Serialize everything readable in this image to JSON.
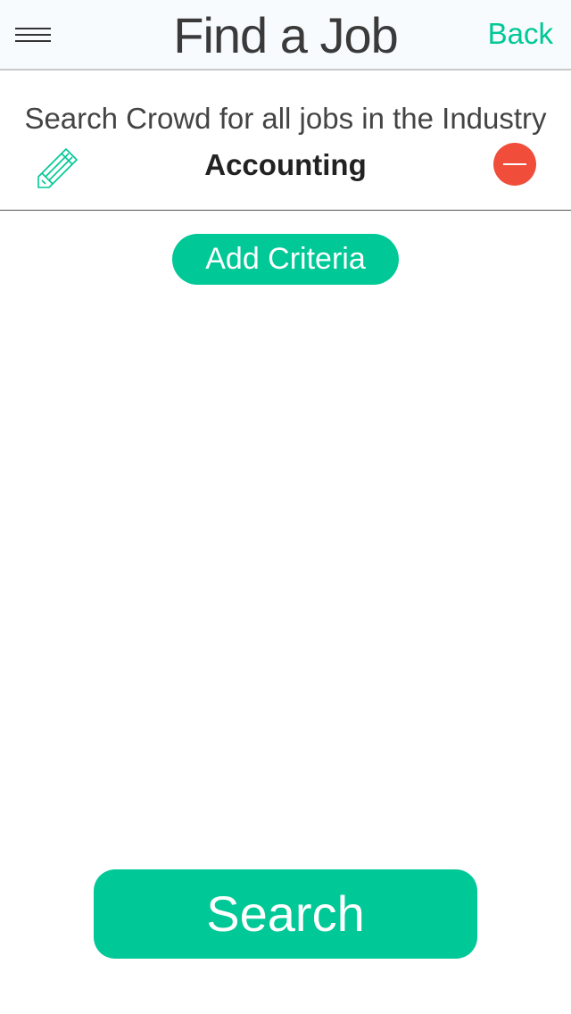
{
  "header": {
    "title": "Find a Job",
    "back_label": "Back",
    "menu_icon": "hamburger-menu-icon"
  },
  "criteria": {
    "description": "Search Crowd for all jobs in the Industry",
    "industry": "Accounting",
    "edit_icon": "pencil-icon",
    "remove_icon": "minus-circle-icon"
  },
  "actions": {
    "add_criteria_label": "Add Criteria",
    "search_label": "Search"
  },
  "colors": {
    "accent": "#00c896",
    "remove": "#f04e3a",
    "header_bg": "#f7fbfd"
  }
}
